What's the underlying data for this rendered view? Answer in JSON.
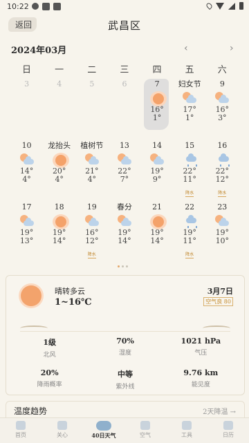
{
  "status": {
    "time": "10:22"
  },
  "header": {
    "back_label": "返回",
    "title": "武昌区"
  },
  "calendar": {
    "month": "2024年03月",
    "prev": "‹",
    "next": "›",
    "weekdays": [
      "日",
      "一",
      "二",
      "三",
      "四",
      "五",
      "六"
    ],
    "rows": [
      [
        {
          "label": "3",
          "dim": true
        },
        {
          "label": "4",
          "dim": true
        },
        {
          "label": "5",
          "dim": true
        },
        {
          "label": "6",
          "dim": true
        },
        {
          "label": "7",
          "icon": "sun",
          "hi": "16°",
          "lo": "1°",
          "today": true
        },
        {
          "label": "妇女节",
          "icon": "cloudy",
          "hi": "17°",
          "lo": "1°"
        },
        {
          "label": "9",
          "icon": "cloudy",
          "hi": "16°",
          "lo": "3°"
        }
      ],
      [
        {
          "label": "10",
          "icon": "cloudy",
          "hi": "14°",
          "lo": "4°"
        },
        {
          "label": "龙抬头",
          "icon": "sun",
          "hi": "20°",
          "lo": "4°"
        },
        {
          "label": "植树节",
          "icon": "cloudy",
          "hi": "21°",
          "lo": "4°"
        },
        {
          "label": "13",
          "icon": "cloudy",
          "hi": "22°",
          "lo": "7°"
        },
        {
          "label": "14",
          "icon": "cloudy",
          "hi": "19°",
          "lo": "9°"
        },
        {
          "label": "15",
          "icon": "rain",
          "hi": "22°",
          "lo": "11°",
          "tag": "降水"
        },
        {
          "label": "16",
          "icon": "rain",
          "hi": "22°",
          "lo": "12°",
          "tag": "降水"
        }
      ],
      [
        {
          "label": "17",
          "icon": "cloudy",
          "hi": "19°",
          "lo": "13°"
        },
        {
          "label": "18",
          "icon": "sun",
          "hi": "19°",
          "lo": "14°"
        },
        {
          "label": "19",
          "icon": "cloudy",
          "hi": "16°",
          "lo": "12°",
          "tag": "降水"
        },
        {
          "label": "春分",
          "icon": "cloudy",
          "hi": "19°",
          "lo": "14°"
        },
        {
          "label": "21",
          "icon": "sun",
          "hi": "19°",
          "lo": "14°"
        },
        {
          "label": "22",
          "icon": "rain",
          "hi": "19°",
          "lo": "11°",
          "tag": "降水"
        },
        {
          "label": "23",
          "icon": "cloudy",
          "hi": "19°",
          "lo": "10°"
        }
      ]
    ]
  },
  "today": {
    "desc": "晴转多云",
    "range": "1~16℃",
    "date": "3月7日",
    "aqi": "空气良 80",
    "metrics": [
      {
        "value": "1级",
        "key": "北风"
      },
      {
        "value": "70%",
        "key": "湿度"
      },
      {
        "value": "1021 hPa",
        "key": "气压"
      },
      {
        "value": "20%",
        "key": "降雨概率"
      },
      {
        "value": "中等",
        "key": "紫外线"
      },
      {
        "value": "9.76 km",
        "key": "能见度"
      }
    ]
  },
  "trend": {
    "title": "温度趋势",
    "right": "2天降温 →"
  },
  "nav": [
    {
      "label": "首页",
      "icon": "home-icon"
    },
    {
      "label": "关心",
      "icon": "heart-icon"
    },
    {
      "label": "40日天气",
      "icon": "weather-icon",
      "active": true
    },
    {
      "label": "空气",
      "icon": "leaf-icon"
    },
    {
      "label": "工具",
      "icon": "tools-icon"
    },
    {
      "label": "日历",
      "icon": "calendar-icon"
    }
  ]
}
